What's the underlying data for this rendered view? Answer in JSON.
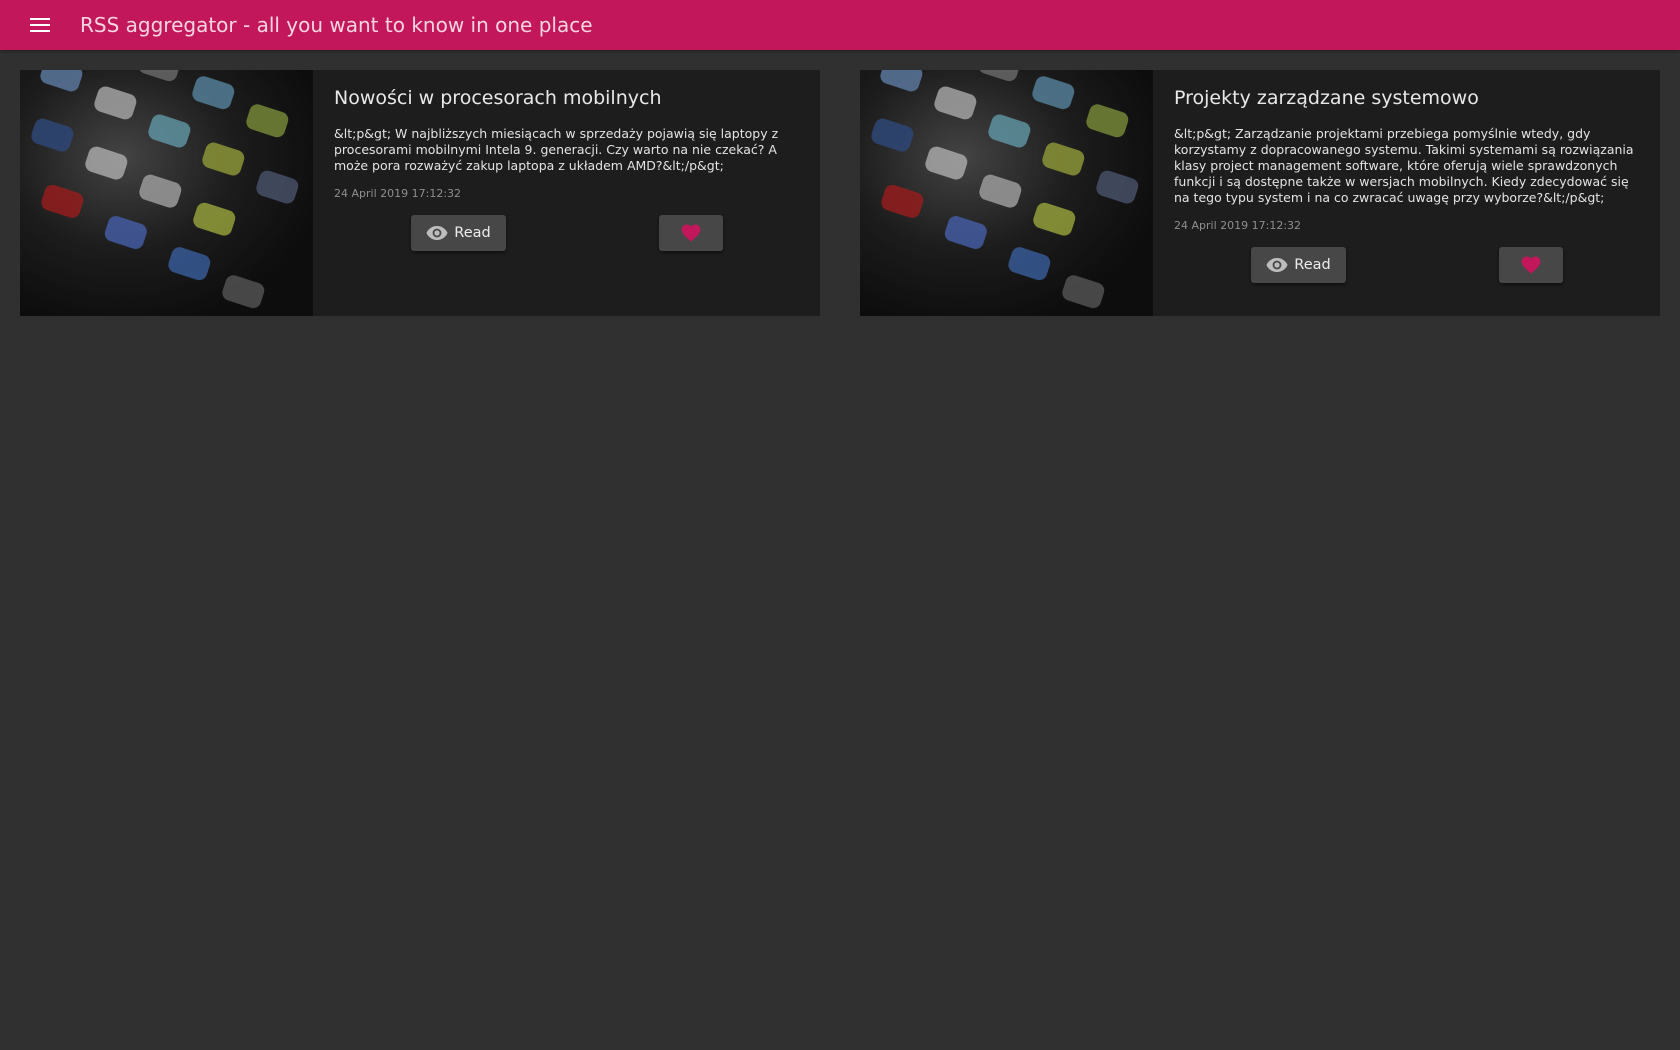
{
  "app": {
    "title": "RSS aggregator - all you want to know in one place",
    "menu_icon": "hamburger-menu-icon",
    "accent_color": "#c2185b",
    "background_color": "#303030"
  },
  "articles": [
    {
      "title": "Nowości w procesorach mobilnych",
      "description": "&lt;p&gt; W najbliższych miesiącach w sprzedaży pojawią się laptopy z procesorami mobilnymi Intela 9. generacji. Czy warto na nie czekać? A może pora rozważyć zakup laptopa z układem AMD?&lt;/p&gt;",
      "date": "24 April 2019 17:12:32",
      "read_label": "Read",
      "read_icon": "eye-icon",
      "favorite_icon": "heart-icon",
      "image_icon": "smartphone-apps-image"
    },
    {
      "title": "Projekty zarządzane systemowo",
      "description": "&lt;p&gt; Zarządzanie projektami przebiega pomyślnie wtedy, gdy korzystamy z dopracowanego systemu. Takimi systemami są rozwiązania klasy project management software, które oferują wiele sprawdzonych funkcji i są dostępne także w wersjach mobilnych. Kiedy zdecydować się na tego typu system i na co zwracać uwagę przy wyborze?&lt;/p&gt;",
      "date": "24 April 2019 17:12:32",
      "read_label": "Read",
      "read_icon": "eye-icon",
      "favorite_icon": "heart-icon",
      "image_icon": "smartphone-apps-image"
    }
  ]
}
